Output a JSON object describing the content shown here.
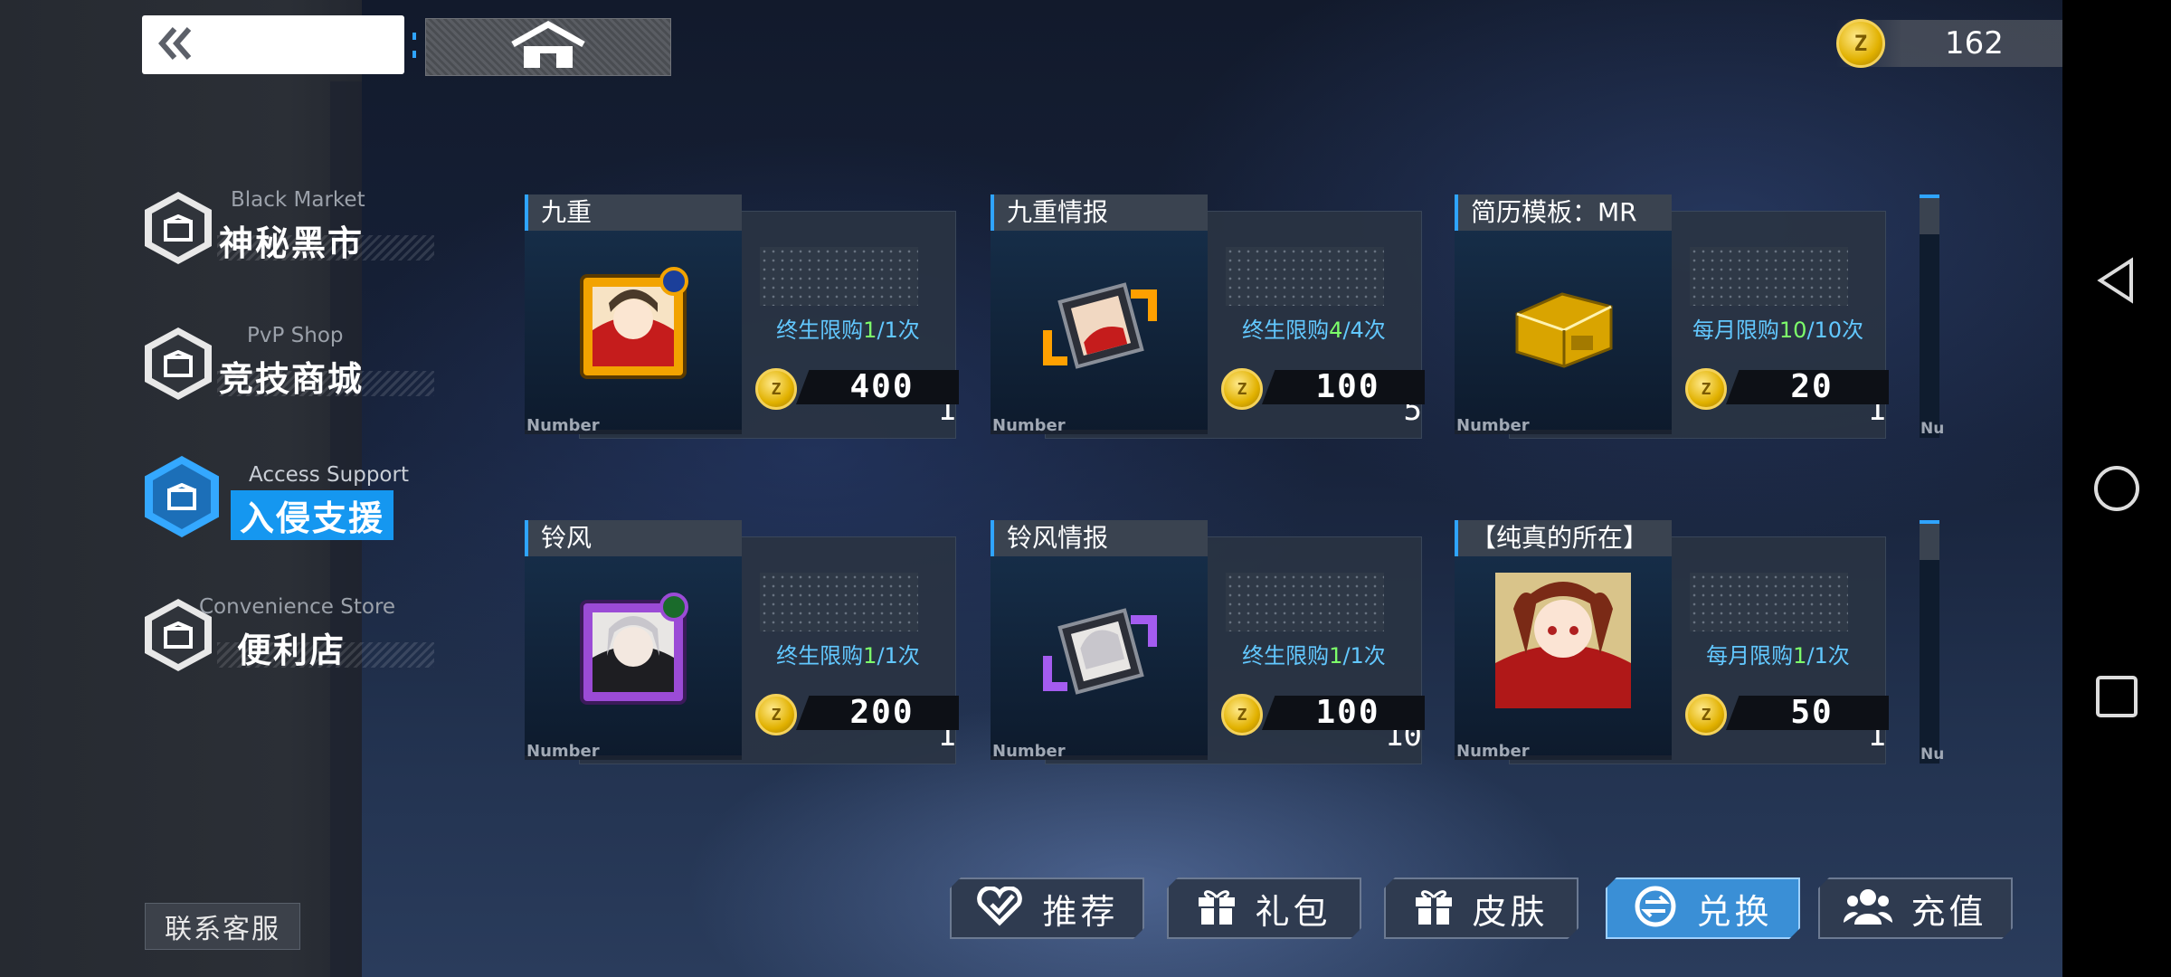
{
  "topbar": {
    "back_icon": "double-chevron-left-icon",
    "home_icon": "home-icon",
    "currency_amount": "162",
    "currency_icon": "z-coin-icon"
  },
  "sidebar": {
    "items": [
      {
        "en": "Black Market",
        "cn": "神秘黑市",
        "active": false
      },
      {
        "en": "PvP Shop",
        "cn": "竞技商城",
        "active": false
      },
      {
        "en": "Access Support",
        "cn": "入侵支援",
        "active": true
      },
      {
        "en": "Convenience Store",
        "cn": "便利店",
        "active": false
      }
    ],
    "contact_label": "联系客服"
  },
  "cards": [
    {
      "title": "九重",
      "number_label": "Number",
      "qty": "1",
      "limit_prefix": "终生限购",
      "limit_used": "1",
      "limit_total": "/1次",
      "price": "400",
      "art": "portrait-frame-gold"
    },
    {
      "title": "九重情报",
      "number_label": "Number",
      "qty": "5",
      "limit_prefix": "终生限购",
      "limit_used": "4",
      "limit_total": "/4次",
      "price": "100",
      "art": "intel-fragment-orange"
    },
    {
      "title": "简历模板：MR",
      "number_label": "Number",
      "qty": "1",
      "limit_prefix": "每月限购",
      "limit_used": "10",
      "limit_total": "/10次",
      "price": "20",
      "art": "gold-box"
    },
    {
      "title": "铃风",
      "number_label": "Number",
      "qty": "1",
      "limit_prefix": "终生限购",
      "limit_used": "1",
      "limit_total": "/1次",
      "price": "200",
      "art": "portrait-frame-purple"
    },
    {
      "title": "铃风情报",
      "number_label": "Number",
      "qty": "10",
      "limit_prefix": "终生限购",
      "limit_used": "1",
      "limit_total": "/1次",
      "price": "100",
      "art": "intel-fragment-purple"
    },
    {
      "title": "【纯真的所在】",
      "number_label": "Number",
      "qty": "1",
      "limit_prefix": "每月限购",
      "limit_used": "1",
      "limit_total": "/1次",
      "price": "50",
      "art": "character-skin-portrait"
    }
  ],
  "partial_label": "Nu",
  "tabs": [
    {
      "label": "推荐",
      "icon": "heart-check-icon",
      "active": false
    },
    {
      "label": "礼包",
      "icon": "gift-icon",
      "active": false
    },
    {
      "label": "皮肤",
      "icon": "gift-icon",
      "active": false
    },
    {
      "label": "兑换",
      "icon": "exchange-icon",
      "active": true
    },
    {
      "label": "充值",
      "icon": "people-icon",
      "active": false
    }
  ],
  "system_nav": {
    "back": "triangle-back-icon",
    "home": "circle-home-icon",
    "recents": "square-recents-icon"
  },
  "colors": {
    "accent": "#2fa4ff",
    "limit_text": "#62c8ff",
    "limit_highlight": "#7dff6a",
    "coin": "#e1b100"
  }
}
